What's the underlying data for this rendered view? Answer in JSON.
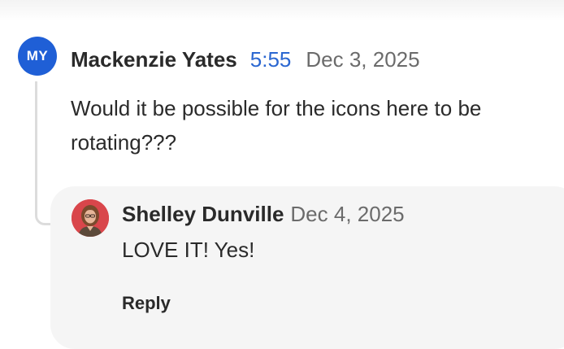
{
  "comment": {
    "avatar_initials": "MY",
    "author": "Mackenzie Yates",
    "time": "5:55",
    "date": "Dec 3, 2025",
    "text": "Would it be possible for the icons here to be rotating???"
  },
  "reply": {
    "author": "Shelley Dunville",
    "date": "Dec 4, 2025",
    "text": "LOVE IT! Yes!",
    "reply_label": "Reply"
  },
  "colors": {
    "avatar_blue": "#1f5fd6",
    "link_blue": "#2b67d1",
    "card_bg": "#f5f5f5"
  }
}
